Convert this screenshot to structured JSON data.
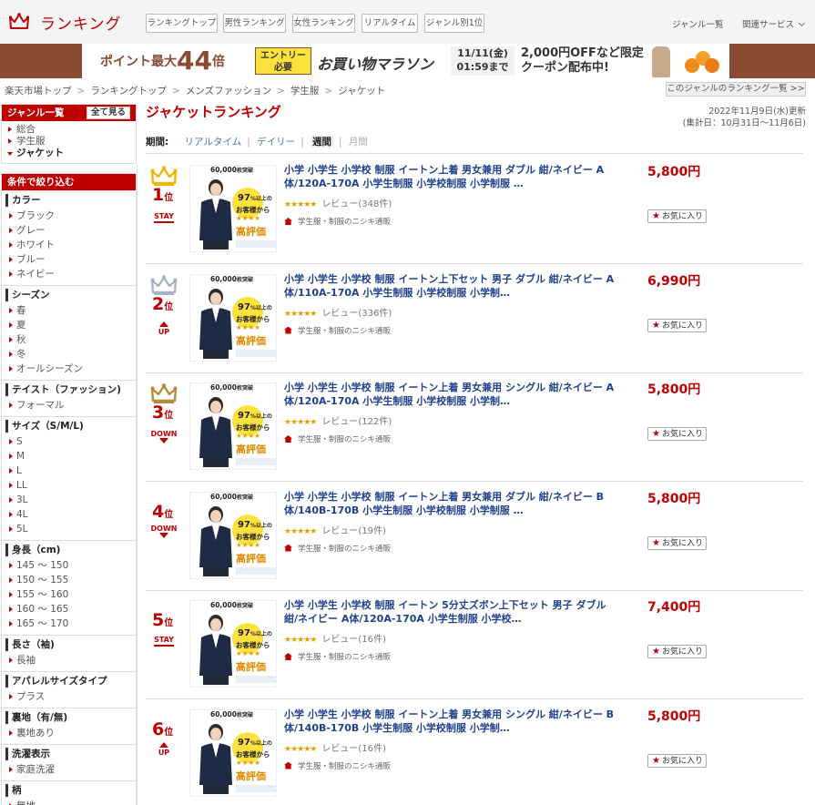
{
  "header": {
    "logo_text": "ランキング",
    "nav_tabs": [
      {
        "label": "ランキングトップ"
      },
      {
        "label": "男性ランキング"
      },
      {
        "label": "女性ランキング"
      },
      {
        "label": "リアルタイム"
      },
      {
        "label": "ジャンル別1位"
      }
    ],
    "genre_link": "ジャンル一覧",
    "services_link": "関連サービス"
  },
  "banner": {
    "point_text": "ポイント最大",
    "point_number": "44",
    "point_unit": "倍",
    "entry_line1": "エントリー",
    "entry_line2": "必要",
    "marathon_text": "お買い物マラソン",
    "date_line1": "11/11(金)",
    "date_line2": "01:59まで",
    "coupon_line1": "2,000円OFFなど限定",
    "coupon_line2": "クーポン配布中!"
  },
  "breadcrumb": [
    "楽天市場トップ",
    "ランキングトップ",
    "メンズファッション",
    "学生服",
    "ジャケット"
  ],
  "genre_list_button": "このジャンルのランキング一覧 >>",
  "sidebar": {
    "genre_title": "ジャンル一覧",
    "show_all": "全て見る",
    "genre_links": [
      {
        "label": "総合",
        "current": false
      },
      {
        "label": "学生服",
        "current": false
      },
      {
        "label": "ジャケット",
        "current": true
      }
    ],
    "filter_title": "条件で絞り込む",
    "filters": [
      {
        "title": "カラー",
        "options": [
          "ブラック",
          "グレー",
          "ホワイト",
          "ブルー",
          "ネイビー"
        ]
      },
      {
        "title": "シーズン",
        "options": [
          "春",
          "夏",
          "秋",
          "冬",
          "オールシーズン"
        ]
      },
      {
        "title": "テイスト（ファッション)",
        "options": [
          "フォーマル"
        ]
      },
      {
        "title": "サイズ（S/M/L)",
        "options": [
          "S",
          "M",
          "L",
          "LL",
          "3L",
          "4L",
          "5L"
        ]
      },
      {
        "title": "身長（cm)",
        "options": [
          "145 ～ 150",
          "150 ～ 155",
          "155 ～ 160",
          "160 ～ 165",
          "165 ～ 170"
        ]
      },
      {
        "title": "長さ（袖)",
        "options": [
          "長袖"
        ]
      },
      {
        "title": "アパレルサイズタイプ",
        "options": [
          "プラス"
        ]
      },
      {
        "title": "裏地（有/無)",
        "options": [
          "裏地あり"
        ]
      },
      {
        "title": "洗濯表示",
        "options": [
          "家庭洗濯"
        ]
      },
      {
        "title": "柄",
        "options": [
          "無地"
        ]
      }
    ]
  },
  "main": {
    "title": "ジャケットランキング",
    "updated": "2022年11月9日(水)更新",
    "period_range": "(集計日：10月31日～11月6日)",
    "period_label": "期間:",
    "period_tabs": [
      {
        "label": "リアルタイム",
        "state": "link"
      },
      {
        "label": "デイリー",
        "state": "link"
      },
      {
        "label": "週間",
        "state": "current"
      },
      {
        "label": "月間",
        "state": "disabled"
      }
    ],
    "rank_suffix": "位",
    "favorite_label": "お気に入り",
    "thumb_top": "60,000",
    "thumb_top_unit": "枚突破",
    "thumb_circle": "97",
    "thumb_circle_unit": "%以上の",
    "thumb_line1": "お客様から",
    "thumb_line2": "★★★★",
    "thumb_hyoka": "高評価",
    "items": [
      {
        "rank": "1",
        "status": "STAY",
        "title": "小学 小学生 小学校 制服 イートン上着 男女兼用 ダブル 紺/ネイビー A体/120A-170A 小学生制服 小学校制服 小学制服 …",
        "stars": "★★★★★",
        "review": "レビュー(348件)",
        "shop": "学生服・制服のニシキ通販",
        "price": "5,800円"
      },
      {
        "rank": "2",
        "status": "UP",
        "title": "小学 小学生 小学校 制服 イートン上下セット 男子 ダブル 紺/ネイビー A体/110A-170A 小学生制服 小学校制服 小学制…",
        "stars": "★★★★★",
        "review": "レビュー(336件)",
        "shop": "学生服・制服のニシキ通販",
        "price": "6,990円"
      },
      {
        "rank": "3",
        "status": "DOWN",
        "title": "小学 小学生 小学校 制服 イートン上着 男女兼用 シングル 紺/ネイビー A体/120A-170A 小学生制服 小学校制服 小学制…",
        "stars": "★★★★★",
        "review": "レビュー(122件)",
        "shop": "学生服・制服のニシキ通販",
        "price": "5,800円"
      },
      {
        "rank": "4",
        "status": "DOWN",
        "title": "小学 小学生 小学校 制服 イートン上着 男女兼用 ダブル 紺/ネイビー B体/140B-170B 小学生制服 小学校制服 小学制服 …",
        "stars": "★★★★★",
        "review": "レビュー(19件)",
        "shop": "学生服・制服のニシキ通販",
        "price": "5,800円"
      },
      {
        "rank": "5",
        "status": "STAY",
        "title": "小学 小学生 小学校 制服 イートン 5分丈ズボン上下セット 男子 ダブル 紺/ネイビー A体/120A-170A 小学生制服 小学校…",
        "stars": "★★★★★",
        "review": "レビュー(16件)",
        "shop": "学生服・制服のニシキ通販",
        "price": "7,400円"
      },
      {
        "rank": "6",
        "status": "UP",
        "title": "小学 小学生 小学校 制服 イートン上着 男女兼用 シングル 紺/ネイビー B体/140B-170B 小学生制服 小学校制服 小学制…",
        "stars": "★★★★★",
        "review": "レビュー(16件)",
        "shop": "学生服・制服のニシキ通販",
        "price": "5,800円"
      }
    ]
  },
  "colors": {
    "accent": "#bf0000",
    "link": "#20418e",
    "banner_frame": "#8a4b32"
  }
}
